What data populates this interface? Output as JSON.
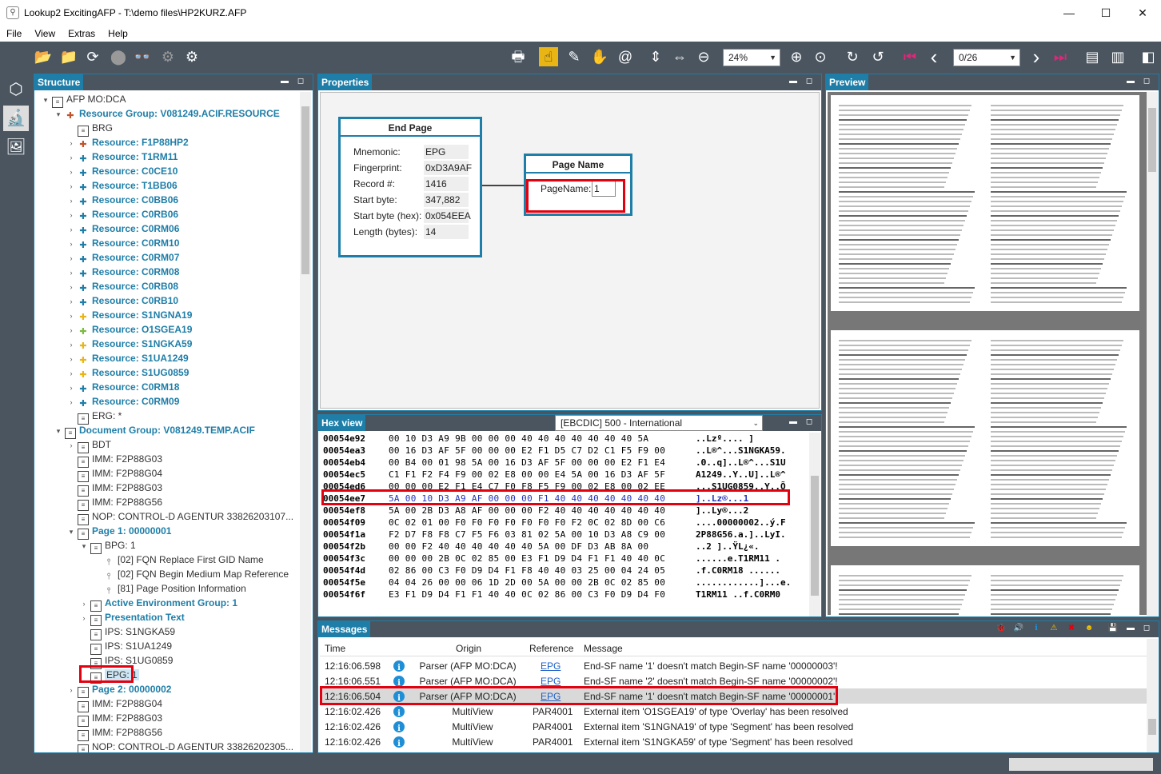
{
  "window": {
    "title": "Lookup2 ExcitingAFP - T:\\demo files\\HP2KURZ.AFP",
    "controls": {
      "minimize": "—",
      "maximize": "☐",
      "close": "✕"
    }
  },
  "menu": [
    "File",
    "View",
    "Extras",
    "Help"
  ],
  "toolbar": {
    "zoom": "24%",
    "page": "0/26",
    "icons": {
      "open": "📂",
      "open_folder": "📁",
      "refresh": "⟳",
      "stop": "⬤",
      "search": "👓",
      "cycle": "⚙",
      "settings": "⚙",
      "print": "🖶",
      "hand_select": "☝",
      "picker": "✎",
      "hand": "✋",
      "spiral": "@",
      "fit_height": "⇕",
      "fit_width": "⇔",
      "zoom_out": "⊖",
      "zoom_in": "⊕",
      "zoom_fit": "⊙",
      "rotate_right": "↻",
      "rotate_left": "↺",
      "first": "⏮",
      "prev": "‹",
      "next": "›",
      "last": "⏭",
      "single_page": "▤",
      "two_page": "▥",
      "side_panel": "◧"
    }
  },
  "sidenav": {
    "icons": [
      "⬡",
      "🔬",
      "🖼"
    ]
  },
  "panels": {
    "structure": "Structure",
    "properties": "Properties",
    "preview": "Preview",
    "hex": "Hex view",
    "messages": "Messages"
  },
  "panel_controls": {
    "pin": "▬",
    "float": "◻"
  },
  "tree": [
    {
      "exp": "▾",
      "icon": "doc",
      "label": "AFP MO:DCA",
      "style": "plain",
      "indent": 0
    },
    {
      "exp": "▾",
      "icon": "puz red",
      "label": "Resource Group: V081249.ACIF.RESOURCE",
      "style": "blue",
      "indent": 1
    },
    {
      "exp": "",
      "icon": "doc",
      "label": "BRG",
      "style": "plain",
      "indent": 2
    },
    {
      "exp": "›",
      "icon": "puz red",
      "label": "Resource: F1P88HP2",
      "style": "blue",
      "indent": 2
    },
    {
      "exp": "›",
      "icon": "puz",
      "label": "Resource: T1RM11",
      "style": "blue",
      "indent": 2
    },
    {
      "exp": "›",
      "icon": "puz",
      "label": "Resource: C0CE10",
      "style": "blue",
      "indent": 2
    },
    {
      "exp": "›",
      "icon": "puz",
      "label": "Resource: T1BB06",
      "style": "blue",
      "indent": 2
    },
    {
      "exp": "›",
      "icon": "puz",
      "label": "Resource: C0BB06",
      "style": "blue",
      "indent": 2
    },
    {
      "exp": "›",
      "icon": "puz",
      "label": "Resource: C0RB06",
      "style": "blue",
      "indent": 2
    },
    {
      "exp": "›",
      "icon": "puz",
      "label": "Resource: C0RM06",
      "style": "blue",
      "indent": 2
    },
    {
      "exp": "›",
      "icon": "puz",
      "label": "Resource: C0RM10",
      "style": "blue",
      "indent": 2
    },
    {
      "exp": "›",
      "icon": "puz",
      "label": "Resource: C0RM07",
      "style": "blue",
      "indent": 2
    },
    {
      "exp": "›",
      "icon": "puz",
      "label": "Resource: C0RM08",
      "style": "blue",
      "indent": 2
    },
    {
      "exp": "›",
      "icon": "puz",
      "label": "Resource: C0RB08",
      "style": "blue",
      "indent": 2
    },
    {
      "exp": "›",
      "icon": "puz",
      "label": "Resource: C0RB10",
      "style": "blue",
      "indent": 2
    },
    {
      "exp": "›",
      "icon": "puz yel",
      "label": "Resource: S1NGNA19",
      "style": "blue",
      "indent": 2
    },
    {
      "exp": "›",
      "icon": "puz grn",
      "label": "Resource: O1SGEA19",
      "style": "blue",
      "indent": 2
    },
    {
      "exp": "›",
      "icon": "puz yel",
      "label": "Resource: S1NGKA59",
      "style": "blue",
      "indent": 2
    },
    {
      "exp": "›",
      "icon": "puz yel",
      "label": "Resource: S1UA1249",
      "style": "blue",
      "indent": 2
    },
    {
      "exp": "›",
      "icon": "puz yel",
      "label": "Resource: S1UG0859",
      "style": "blue",
      "indent": 2
    },
    {
      "exp": "›",
      "icon": "puz",
      "label": "Resource: C0RM18",
      "style": "blue",
      "indent": 2
    },
    {
      "exp": "›",
      "icon": "puz",
      "label": "Resource: C0RM09",
      "style": "blue",
      "indent": 2
    },
    {
      "exp": "",
      "icon": "doc",
      "label": "ERG: *",
      "style": "plain",
      "indent": 2
    },
    {
      "exp": "▾",
      "icon": "doc",
      "label": "Document Group: V081249.TEMP.ACIF",
      "style": "blue",
      "indent": 1
    },
    {
      "exp": "›",
      "icon": "doc",
      "label": "BDT",
      "style": "plain",
      "indent": 2
    },
    {
      "exp": "",
      "icon": "doc",
      "label": "IMM: F2P88G03",
      "style": "plain",
      "indent": 2
    },
    {
      "exp": "",
      "icon": "doc",
      "label": "IMM: F2P88G04",
      "style": "plain",
      "indent": 2
    },
    {
      "exp": "",
      "icon": "doc",
      "label": "IMM: F2P88G03",
      "style": "plain",
      "indent": 2
    },
    {
      "exp": "",
      "icon": "doc",
      "label": "IMM: F2P88G56",
      "style": "plain",
      "indent": 2
    },
    {
      "exp": "",
      "icon": "doc",
      "label": "NOP: CONTROL-D AGENTUR  33826203107...",
      "style": "plain",
      "indent": 2
    },
    {
      "exp": "▾",
      "icon": "doc",
      "label": "Page 1: 00000001",
      "style": "blue",
      "indent": 2
    },
    {
      "exp": "▾",
      "icon": "doc",
      "label": "BPG: 1",
      "style": "plain",
      "indent": 3
    },
    {
      "exp": "",
      "icon": "pin",
      "label": "[02] FQN Replace First GID Name",
      "style": "plain",
      "indent": 4
    },
    {
      "exp": "",
      "icon": "pin",
      "label": "[02] FQN Begin Medium Map Reference",
      "style": "plain",
      "indent": 4
    },
    {
      "exp": "",
      "icon": "pin",
      "label": "[81] Page Position Information",
      "style": "plain",
      "indent": 4
    },
    {
      "exp": "›",
      "icon": "doc",
      "label": "Active Environment Group: 1",
      "style": "blue",
      "indent": 3
    },
    {
      "exp": "›",
      "icon": "doc",
      "label": "Presentation Text",
      "style": "blue",
      "indent": 3
    },
    {
      "exp": "",
      "icon": "doc",
      "label": "IPS: S1NGKA59",
      "style": "plain",
      "indent": 3
    },
    {
      "exp": "",
      "icon": "doc",
      "label": "IPS: S1UA1249",
      "style": "plain",
      "indent": 3
    },
    {
      "exp": "",
      "icon": "doc",
      "label": "IPS: S1UG0859",
      "style": "plain",
      "indent": 3
    },
    {
      "exp": "",
      "icon": "doc",
      "label": "EPG: 1",
      "style": "sel",
      "indent": 3
    },
    {
      "exp": "›",
      "icon": "doc",
      "label": "Page 2: 00000002",
      "style": "blue",
      "indent": 2
    },
    {
      "exp": "",
      "icon": "doc",
      "label": "IMM: F2P88G04",
      "style": "plain",
      "indent": 2
    },
    {
      "exp": "",
      "icon": "doc",
      "label": "IMM: F2P88G03",
      "style": "plain",
      "indent": 2
    },
    {
      "exp": "",
      "icon": "doc",
      "label": "IMM: F2P88G56",
      "style": "plain",
      "indent": 2
    },
    {
      "exp": "",
      "icon": "doc",
      "label": "NOP: CONTROL-D AGENTUR  33826202305...",
      "style": "plain",
      "indent": 2
    }
  ],
  "end_page": {
    "title": "End Page",
    "rows": [
      {
        "k": "Mnemonic:",
        "v": "EPG"
      },
      {
        "k": "Fingerprint:",
        "v": "0xD3A9AF"
      },
      {
        "k": "Record #:",
        "v": "1416"
      },
      {
        "k": "Start byte:",
        "v": "347,882"
      },
      {
        "k": "Start byte (hex):",
        "v": "0x054EEA"
      },
      {
        "k": "Length (bytes):",
        "v": "14"
      }
    ]
  },
  "page_name": {
    "title": "Page Name",
    "label": "PageName:",
    "value": "1"
  },
  "hex": {
    "encoding": "[EBCDIC] 500  - International",
    "rows": [
      {
        "a": "00054e92",
        "b": "00 10 D3 A9 9B 00 00 00 40 40 40 40 40 40 40 5A",
        "t": "..Lzº....       ]",
        "hl": false
      },
      {
        "a": "00054ea3",
        "b": "00 16 D3 AF 5F 00 00 00 E2 F1 D5 C7 D2 C1 F5 F9 00",
        "t": "..L®^...S1NGKA59.",
        "hl": false
      },
      {
        "a": "00054eb4",
        "b": "00 B4 00 01 98 5A 00 16 D3 AF 5F 00 00 00 E2 F1 E4",
        "t": ".Θ..q]..L®^...S1U",
        "hl": false
      },
      {
        "a": "00054ec5",
        "b": "C1 F1 F2 F4 F9 00 02 E8 00 00 E4 5A 00 16 D3 AF 5F",
        "t": "A1249..Y..U]..L®^",
        "hl": false
      },
      {
        "a": "00054ed6",
        "b": "00 00 00 E2 F1 E4 C7 F0 F8 F5 F9 00 02 E8 00 02 EE",
        "t": "...S1UG0859..Y..Õ",
        "hl": false
      },
      {
        "a": "00054ee7",
        "b": "5A 00 10 D3 A9 AF 00 00 00 F1 40 40 40 40 40 40 40",
        "t": "]..Lz®...1",
        "hl": true
      },
      {
        "a": "00054ef8",
        "b": "5A 00 2B D3 A8 AF 00 00 00 F2 40 40 40 40 40 40 40",
        "t": "]..Ly®...2",
        "hl": false
      },
      {
        "a": "00054f09",
        "b": "0C 02 01 00 F0 F0 F0 F0 F0 F0 F0 F2 0C 02 8D 00 C6",
        "t": "....00000002..ý.F",
        "hl": false
      },
      {
        "a": "00054f1a",
        "b": "F2 D7 F8 F8 C7 F5 F6 03 81 02 5A 00 10 D3 A8 C9 00",
        "t": "2P88G56.a.]..LyI.",
        "hl": false
      },
      {
        "a": "00054f2b",
        "b": "00 00 F2 40 40 40 40 40 40 5A 00 DF D3 AB 8A 00",
        "t": "..2        ]..ŸL¿«.",
        "hl": false
      },
      {
        "a": "00054f3c",
        "b": "00 00 00 2B 0C 02 85 00 E3 F1 D9 D4 F1 F1 40 40 0C",
        "t": "......e.T1RM11  .",
        "hl": false
      },
      {
        "a": "00054f4d",
        "b": "02 86 00 C3 F0 D9 D4 F1 F8 40 40 03 25 00 04 24 05",
        "t": ".f.C0RM18  ......",
        "hl": false
      },
      {
        "a": "00054f5e",
        "b": "04 04 26 00 00 06 1D 2D 00 5A 00 00 2B 0C 02 85 00",
        "t": "............]...e.",
        "hl": false
      },
      {
        "a": "00054f6f",
        "b": "E3 F1 D9 D4 F1 F1 40 40 0C 02 86 00 C3 F0 D9 D4 F0",
        "t": "T1RM11  ..f.C0RM0",
        "hl": false
      }
    ]
  },
  "messages": {
    "columns": {
      "time": "Time",
      "origin": "Origin",
      "reference": "Reference",
      "message": "Message"
    },
    "toolbar_icons": [
      "🐞",
      "🔊",
      "ℹ",
      "⚠",
      "✖",
      "☻",
      "💾"
    ],
    "rows": [
      {
        "time": "12:16:06.598",
        "origin": "Parser (AFP MO:DCA)",
        "ref": "EPG",
        "msg": "End-SF name '1' doesn't match Begin-SF name '00000003'!",
        "sel": false,
        "link": true
      },
      {
        "time": "12:16:06.551",
        "origin": "Parser (AFP MO:DCA)",
        "ref": "EPG",
        "msg": "End-SF name '2' doesn't match Begin-SF name '00000002'!",
        "sel": false,
        "link": true
      },
      {
        "time": "12:16:06.504",
        "origin": "Parser (AFP MO:DCA)",
        "ref": "EPG",
        "msg": "End-SF name '1' doesn't match Begin-SF name '00000001'!",
        "sel": true,
        "link": true
      },
      {
        "time": "12:16:02.426",
        "origin": "MultiView",
        "ref": "PAR4001",
        "msg": "External item 'O1SGEA19' of type 'Overlay' has been resolved",
        "sel": false,
        "link": false
      },
      {
        "time": "12:16:02.426",
        "origin": "MultiView",
        "ref": "PAR4001",
        "msg": "External item 'S1NGNA19' of type 'Segment' has been resolved",
        "sel": false,
        "link": false
      },
      {
        "time": "12:16:02.426",
        "origin": "MultiView",
        "ref": "PAR4001",
        "msg": "External item 'S1NGKA59' of type 'Segment' has been resolved",
        "sel": false,
        "link": false
      }
    ],
    "info_glyph": "i"
  }
}
